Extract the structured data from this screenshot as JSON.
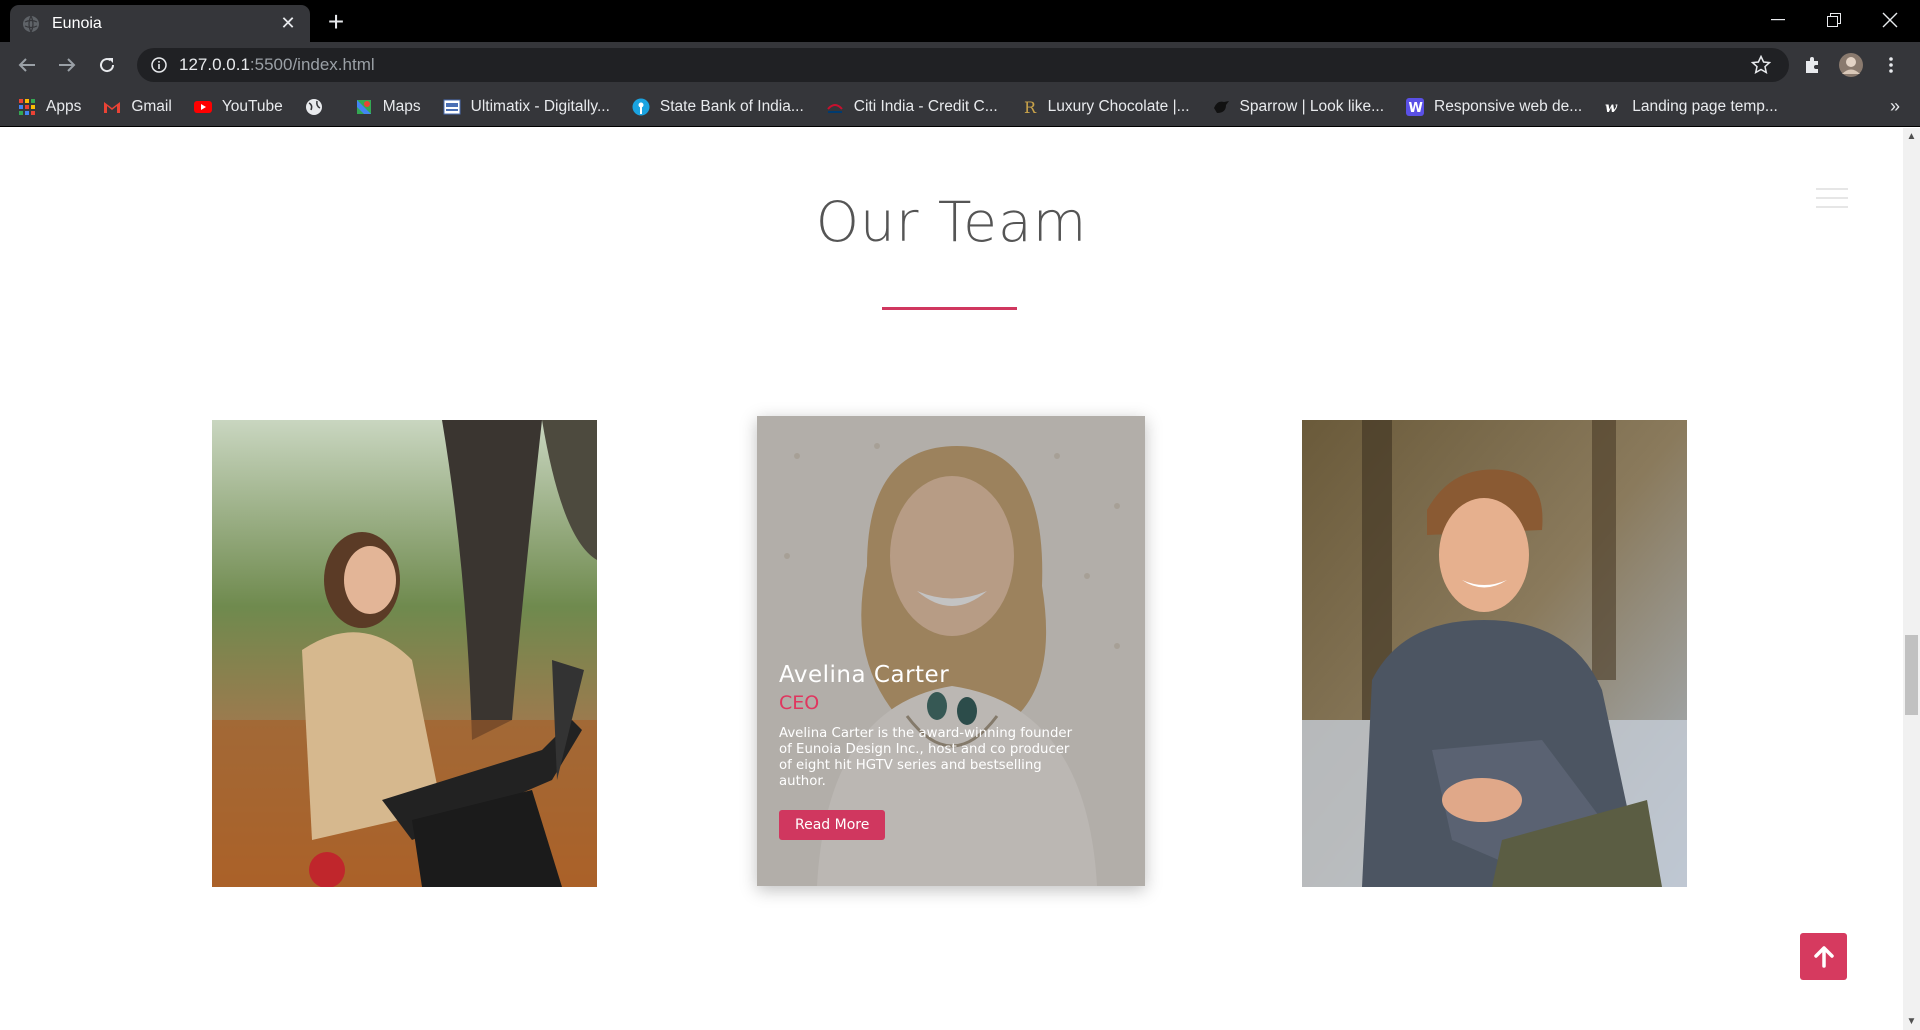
{
  "browser": {
    "tab_title": "Eunoia",
    "url_host": "127.0.0.1",
    "url_path": ":5500/index.html",
    "bookmarks": [
      {
        "label": "Apps",
        "icon": "apps-grid-icon"
      },
      {
        "label": "Gmail",
        "icon": "gmail-icon"
      },
      {
        "label": "YouTube",
        "icon": "youtube-icon"
      },
      {
        "label": "",
        "icon": "globe-icon"
      },
      {
        "label": "Maps",
        "icon": "maps-icon"
      },
      {
        "label": "Ultimatix - Digitally...",
        "icon": "tata-icon"
      },
      {
        "label": "State Bank of India...",
        "icon": "sbi-icon"
      },
      {
        "label": "Citi India - Credit C...",
        "icon": "citi-icon"
      },
      {
        "label": "Luxury Chocolate |...",
        "icon": "r-icon"
      },
      {
        "label": "Sparrow | Look like...",
        "icon": "sparrow-icon"
      },
      {
        "label": "Responsive web de...",
        "icon": "w-icon"
      },
      {
        "label": "Landing page temp...",
        "icon": "w-italic-icon"
      }
    ],
    "more_label": "»"
  },
  "page": {
    "section_title": "Our Team",
    "accent_color": "#d0375f",
    "featured_member": {
      "name": "Avelina Carter",
      "role": "CEO",
      "bio": "Avelina Carter is the award-winning founder of Eunoia Design Inc., host and co producer of eight hit HGTV series and bestselling author.",
      "button_label": "Read More"
    }
  }
}
